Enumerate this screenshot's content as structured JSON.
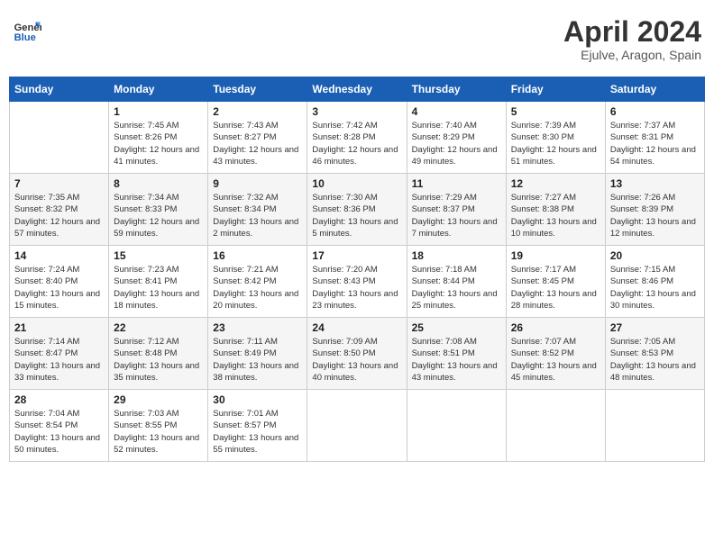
{
  "header": {
    "logo_line1": "General",
    "logo_line2": "Blue",
    "month_title": "April 2024",
    "subtitle": "Ejulve, Aragon, Spain"
  },
  "days_of_week": [
    "Sunday",
    "Monday",
    "Tuesday",
    "Wednesday",
    "Thursday",
    "Friday",
    "Saturday"
  ],
  "weeks": [
    [
      {
        "day": "",
        "sunrise": "",
        "sunset": "",
        "daylight": ""
      },
      {
        "day": "1",
        "sunrise": "Sunrise: 7:45 AM",
        "sunset": "Sunset: 8:26 PM",
        "daylight": "Daylight: 12 hours and 41 minutes."
      },
      {
        "day": "2",
        "sunrise": "Sunrise: 7:43 AM",
        "sunset": "Sunset: 8:27 PM",
        "daylight": "Daylight: 12 hours and 43 minutes."
      },
      {
        "day": "3",
        "sunrise": "Sunrise: 7:42 AM",
        "sunset": "Sunset: 8:28 PM",
        "daylight": "Daylight: 12 hours and 46 minutes."
      },
      {
        "day": "4",
        "sunrise": "Sunrise: 7:40 AM",
        "sunset": "Sunset: 8:29 PM",
        "daylight": "Daylight: 12 hours and 49 minutes."
      },
      {
        "day": "5",
        "sunrise": "Sunrise: 7:39 AM",
        "sunset": "Sunset: 8:30 PM",
        "daylight": "Daylight: 12 hours and 51 minutes."
      },
      {
        "day": "6",
        "sunrise": "Sunrise: 7:37 AM",
        "sunset": "Sunset: 8:31 PM",
        "daylight": "Daylight: 12 hours and 54 minutes."
      }
    ],
    [
      {
        "day": "7",
        "sunrise": "Sunrise: 7:35 AM",
        "sunset": "Sunset: 8:32 PM",
        "daylight": "Daylight: 12 hours and 57 minutes."
      },
      {
        "day": "8",
        "sunrise": "Sunrise: 7:34 AM",
        "sunset": "Sunset: 8:33 PM",
        "daylight": "Daylight: 12 hours and 59 minutes."
      },
      {
        "day": "9",
        "sunrise": "Sunrise: 7:32 AM",
        "sunset": "Sunset: 8:34 PM",
        "daylight": "Daylight: 13 hours and 2 minutes."
      },
      {
        "day": "10",
        "sunrise": "Sunrise: 7:30 AM",
        "sunset": "Sunset: 8:36 PM",
        "daylight": "Daylight: 13 hours and 5 minutes."
      },
      {
        "day": "11",
        "sunrise": "Sunrise: 7:29 AM",
        "sunset": "Sunset: 8:37 PM",
        "daylight": "Daylight: 13 hours and 7 minutes."
      },
      {
        "day": "12",
        "sunrise": "Sunrise: 7:27 AM",
        "sunset": "Sunset: 8:38 PM",
        "daylight": "Daylight: 13 hours and 10 minutes."
      },
      {
        "day": "13",
        "sunrise": "Sunrise: 7:26 AM",
        "sunset": "Sunset: 8:39 PM",
        "daylight": "Daylight: 13 hours and 12 minutes."
      }
    ],
    [
      {
        "day": "14",
        "sunrise": "Sunrise: 7:24 AM",
        "sunset": "Sunset: 8:40 PM",
        "daylight": "Daylight: 13 hours and 15 minutes."
      },
      {
        "day": "15",
        "sunrise": "Sunrise: 7:23 AM",
        "sunset": "Sunset: 8:41 PM",
        "daylight": "Daylight: 13 hours and 18 minutes."
      },
      {
        "day": "16",
        "sunrise": "Sunrise: 7:21 AM",
        "sunset": "Sunset: 8:42 PM",
        "daylight": "Daylight: 13 hours and 20 minutes."
      },
      {
        "day": "17",
        "sunrise": "Sunrise: 7:20 AM",
        "sunset": "Sunset: 8:43 PM",
        "daylight": "Daylight: 13 hours and 23 minutes."
      },
      {
        "day": "18",
        "sunrise": "Sunrise: 7:18 AM",
        "sunset": "Sunset: 8:44 PM",
        "daylight": "Daylight: 13 hours and 25 minutes."
      },
      {
        "day": "19",
        "sunrise": "Sunrise: 7:17 AM",
        "sunset": "Sunset: 8:45 PM",
        "daylight": "Daylight: 13 hours and 28 minutes."
      },
      {
        "day": "20",
        "sunrise": "Sunrise: 7:15 AM",
        "sunset": "Sunset: 8:46 PM",
        "daylight": "Daylight: 13 hours and 30 minutes."
      }
    ],
    [
      {
        "day": "21",
        "sunrise": "Sunrise: 7:14 AM",
        "sunset": "Sunset: 8:47 PM",
        "daylight": "Daylight: 13 hours and 33 minutes."
      },
      {
        "day": "22",
        "sunrise": "Sunrise: 7:12 AM",
        "sunset": "Sunset: 8:48 PM",
        "daylight": "Daylight: 13 hours and 35 minutes."
      },
      {
        "day": "23",
        "sunrise": "Sunrise: 7:11 AM",
        "sunset": "Sunset: 8:49 PM",
        "daylight": "Daylight: 13 hours and 38 minutes."
      },
      {
        "day": "24",
        "sunrise": "Sunrise: 7:09 AM",
        "sunset": "Sunset: 8:50 PM",
        "daylight": "Daylight: 13 hours and 40 minutes."
      },
      {
        "day": "25",
        "sunrise": "Sunrise: 7:08 AM",
        "sunset": "Sunset: 8:51 PM",
        "daylight": "Daylight: 13 hours and 43 minutes."
      },
      {
        "day": "26",
        "sunrise": "Sunrise: 7:07 AM",
        "sunset": "Sunset: 8:52 PM",
        "daylight": "Daylight: 13 hours and 45 minutes."
      },
      {
        "day": "27",
        "sunrise": "Sunrise: 7:05 AM",
        "sunset": "Sunset: 8:53 PM",
        "daylight": "Daylight: 13 hours and 48 minutes."
      }
    ],
    [
      {
        "day": "28",
        "sunrise": "Sunrise: 7:04 AM",
        "sunset": "Sunset: 8:54 PM",
        "daylight": "Daylight: 13 hours and 50 minutes."
      },
      {
        "day": "29",
        "sunrise": "Sunrise: 7:03 AM",
        "sunset": "Sunset: 8:55 PM",
        "daylight": "Daylight: 13 hours and 52 minutes."
      },
      {
        "day": "30",
        "sunrise": "Sunrise: 7:01 AM",
        "sunset": "Sunset: 8:57 PM",
        "daylight": "Daylight: 13 hours and 55 minutes."
      },
      {
        "day": "",
        "sunrise": "",
        "sunset": "",
        "daylight": ""
      },
      {
        "day": "",
        "sunrise": "",
        "sunset": "",
        "daylight": ""
      },
      {
        "day": "",
        "sunrise": "",
        "sunset": "",
        "daylight": ""
      },
      {
        "day": "",
        "sunrise": "",
        "sunset": "",
        "daylight": ""
      }
    ]
  ],
  "accent_color": "#1a5fb4"
}
